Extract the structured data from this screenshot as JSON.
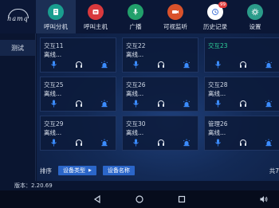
{
  "logo": {
    "text": "hamq"
  },
  "nav": [
    {
      "label": "呼叫分机",
      "icon": "phone-book-icon",
      "color": "#1a9e8f",
      "active": true
    },
    {
      "label": "呼叫主机",
      "icon": "host-icon",
      "color": "#d9393d"
    },
    {
      "label": "广播",
      "icon": "microphone-icon",
      "color": "#22a06b"
    },
    {
      "label": "可视监听",
      "icon": "camera-icon",
      "color": "#d9522b"
    },
    {
      "label": "历史记录",
      "icon": "history-icon",
      "color": "#ffffff",
      "badge": "99"
    },
    {
      "label": "设置",
      "icon": "gear-icon",
      "color": "#2b9c8a"
    }
  ],
  "sidebar": {
    "items": [
      {
        "label": "测试"
      }
    ]
  },
  "cards": [
    {
      "name": "交互11",
      "status": "离线...",
      "green": false
    },
    {
      "name": "交互22",
      "status": "离线...",
      "green": false
    },
    {
      "name": "交互23",
      "status": "",
      "green": true
    },
    {
      "name": "交互25",
      "status": "离线...",
      "green": false
    },
    {
      "name": "交互26",
      "status": "离线...",
      "green": false
    },
    {
      "name": "交互28",
      "status": "离线...",
      "green": false
    },
    {
      "name": "交互29",
      "status": "离线...",
      "green": false
    },
    {
      "name": "交互30",
      "status": "离线...",
      "green": false
    },
    {
      "name": "管理26",
      "status": "离线...",
      "green": false
    }
  ],
  "sort": {
    "label": "排序",
    "by_type": "设备类型",
    "by_name": "设备名称",
    "total_prefix": "共7"
  },
  "version": "版本：2.20.69",
  "colors": {
    "accent": "#2b66c9",
    "online": "#2fd39b",
    "icon_blue": "#3b8cff"
  }
}
